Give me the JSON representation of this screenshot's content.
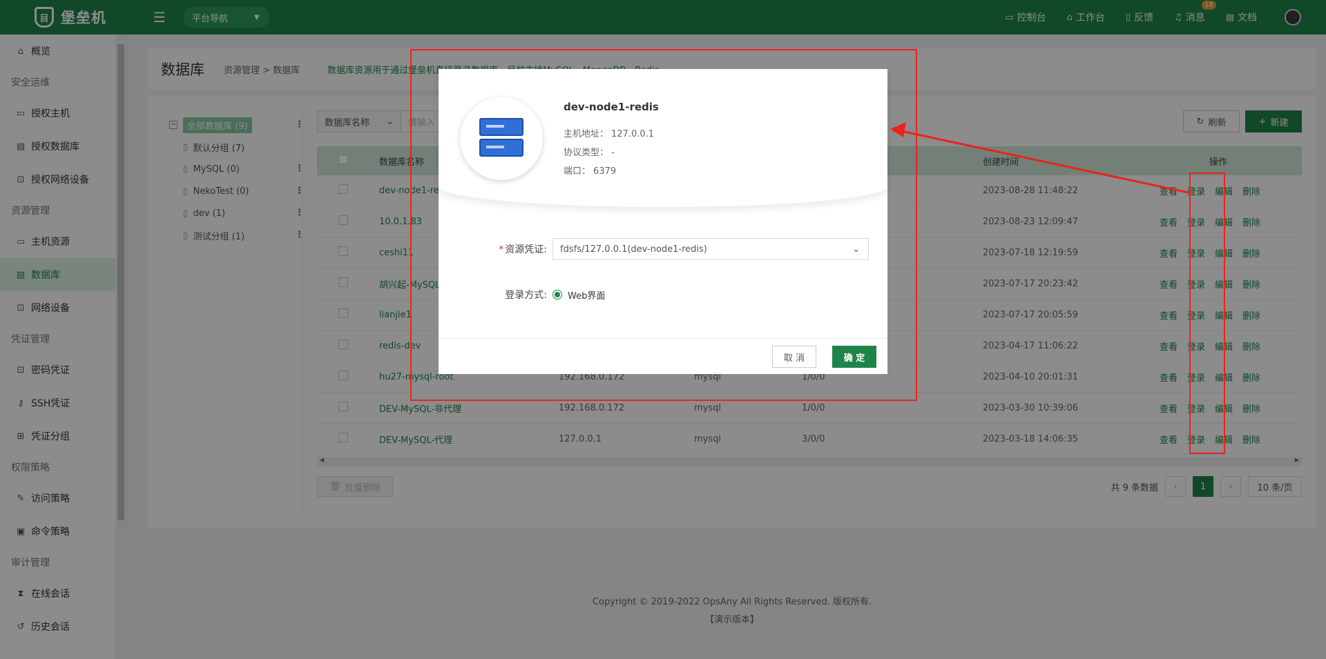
{
  "header": {
    "logo_text": "堡垒机",
    "platform_nav": "平台导航",
    "links": [
      {
        "label": "控制台",
        "icon": "monitor-icon"
      },
      {
        "label": "工作台",
        "icon": "home-icon"
      },
      {
        "label": "反馈",
        "icon": "feedback-icon"
      },
      {
        "label": "消息",
        "icon": "bell-icon",
        "badge": "18"
      },
      {
        "label": "文档",
        "icon": "doc-icon"
      }
    ]
  },
  "sidebar": {
    "overview": "概览",
    "group1": "安全运维",
    "auth_host": "授权主机",
    "auth_db": "授权数据库",
    "auth_net": "授权网络设备",
    "group2": "资源管理",
    "host_res": "主机资源",
    "db": "数据库",
    "net_dev": "网络设备",
    "group3": "凭证管理",
    "pwd_cred": "密码凭证",
    "ssh_cred": "SSH凭证",
    "cred_group": "凭证分组",
    "group4": "权限策略",
    "access_policy": "访问策略",
    "cmd_policy": "命令策略",
    "group5": "审计管理",
    "online_session": "在线会话",
    "history_session": "历史会话"
  },
  "page": {
    "title": "数据库",
    "breadcrumb": "资源管理  >  数据库",
    "desc": "数据库资源用于通过堡垒机直接登录数据库，目前支持MySQL、MongoDB、Redis"
  },
  "tree": {
    "root": "全部数据库 (9)",
    "items": [
      "默认分组 (7)",
      "MySQL (0)",
      "NekoTest (0)",
      "dev (1)",
      "测试分组 (1)"
    ]
  },
  "toolbar": {
    "select": "数据库名称",
    "search_placeholder": "请输入",
    "refresh": "刷新",
    "new": "新建"
  },
  "table": {
    "headers": {
      "name": "数据库名称",
      "time": "创建时间",
      "ops": "操作"
    },
    "rows": [
      {
        "name": "dev-node1-redis",
        "ip": "",
        "type": "",
        "count": "",
        "time": "2023-08-28 11:48:22"
      },
      {
        "name": "10.0.1.83",
        "ip": "",
        "type": "",
        "count": "",
        "time": "2023-08-23 12:09:47"
      },
      {
        "name": "ceshi11",
        "ip": "",
        "type": "",
        "count": "",
        "time": "2023-07-18 12:19:59"
      },
      {
        "name": "胡兴起-MySQL",
        "ip": "",
        "type": "",
        "count": "",
        "time": "2023-07-17 20:23:42"
      },
      {
        "name": "lianjie1",
        "ip": "",
        "type": "",
        "count": "",
        "time": "2023-07-17 20:05:59"
      },
      {
        "name": "redis-dev",
        "ip": "",
        "type": "",
        "count": "",
        "time": "2023-04-17 11:06:22"
      },
      {
        "name": "hu27-mysql-root",
        "ip": "192.168.0.172",
        "type": "mysql",
        "count": "1/0/0",
        "time": "2023-04-10 20:01:31"
      },
      {
        "name": "DEV-MySQL-非代理",
        "ip": "192.168.0.172",
        "type": "mysql",
        "count": "1/0/0",
        "time": "2023-03-30 10:39:06"
      },
      {
        "name": "DEV-MySQL-代理",
        "ip": "127.0.0.1",
        "type": "mysql",
        "count": "3/0/0",
        "time": "2023-03-18 14:06:35"
      }
    ],
    "ops": {
      "view": "查看",
      "login": "登录",
      "edit": "编辑",
      "delete": "删除"
    }
  },
  "batch_delete": "批量删除",
  "pager": {
    "total": "共 9 条数据",
    "current": "1",
    "size": "10 条/页"
  },
  "footer": {
    "copyright": "Copyright © 2019-2022 OpsAny All Rights Reserved. 版权所有.",
    "demo": "【演示版本】"
  },
  "modal": {
    "name": "dev-node1-redis",
    "host_label": "主机地址：",
    "host_value": "127.0.0.1",
    "proto_label": "协议类型：",
    "proto_value": "-",
    "port_label": "端口：",
    "port_value": "6379",
    "cred_label": "资源凭证:",
    "cred_value": "fdsfs/127.0.0.1(dev-node1-redis)",
    "login_label": "登录方式:",
    "login_value": "Web界面",
    "cancel": "取 消",
    "ok": "确 定"
  },
  "colors": {
    "brand": "#1e8449",
    "annotation": "#e8241c"
  }
}
